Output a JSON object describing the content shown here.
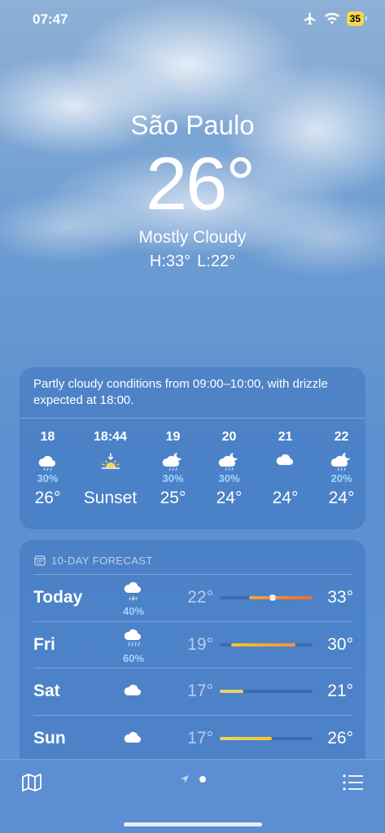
{
  "status": {
    "time": "07:47",
    "battery": "35",
    "icons": [
      "airplane-icon",
      "wifi-icon",
      "battery-icon"
    ]
  },
  "location": {
    "city": "São Paulo",
    "temperature": "26°",
    "condition": "Mostly Cloudy",
    "high": "H:33°",
    "low": "L:22°"
  },
  "hourly": {
    "summary": "Partly cloudy conditions from 09:00–10:00, with drizzle expected at 18:00.",
    "items": [
      {
        "time": "18",
        "icon": "drizzle-cloud-icon",
        "pop": "30%",
        "temp": "26°"
      },
      {
        "time": "18:44",
        "icon": "sunset-icon",
        "pop": "",
        "temp": "Sunset"
      },
      {
        "time": "19",
        "icon": "drizzle-cloud-moon-icon",
        "pop": "30%",
        "temp": "25°"
      },
      {
        "time": "20",
        "icon": "drizzle-cloud-moon-icon",
        "pop": "30%",
        "temp": "24°"
      },
      {
        "time": "21",
        "icon": "cloud-icon",
        "pop": "",
        "temp": "24°"
      },
      {
        "time": "22",
        "icon": "drizzle-cloud-moon-icon",
        "pop": "20%",
        "temp": "24°"
      }
    ]
  },
  "daily": {
    "header": "10-DAY FORECAST",
    "range_min": 17,
    "range_max": 33,
    "days": [
      {
        "name": "Today",
        "icon": "thunderstorm-cloud-icon",
        "pop": "40%",
        "low": "22°",
        "high": "33°",
        "low_value": 22,
        "high_value": 33,
        "current_value": 26,
        "color_from": "#f7a33a",
        "color_to": "#f26b25"
      },
      {
        "name": "Fri",
        "icon": "rain-cloud-icon",
        "pop": "60%",
        "low": "19°",
        "high": "30°",
        "low_value": 19,
        "high_value": 30,
        "color_from": "#f2c330",
        "color_to": "#f3922e"
      },
      {
        "name": "Sat",
        "icon": "cloud-icon",
        "pop": "",
        "low": "17°",
        "high": "21°",
        "low_value": 17,
        "high_value": 21,
        "color_from": "#d8d86a",
        "color_to": "#e8d45a"
      },
      {
        "name": "Sun",
        "icon": "cloud-icon",
        "pop": "",
        "low": "17°",
        "high": "26°",
        "low_value": 17,
        "high_value": 26,
        "color_from": "#e6d95c",
        "color_to": "#f6c42e"
      }
    ]
  },
  "toolbar": {
    "map": "map-icon",
    "location": "location-arrow-icon",
    "list": "list-icon"
  }
}
